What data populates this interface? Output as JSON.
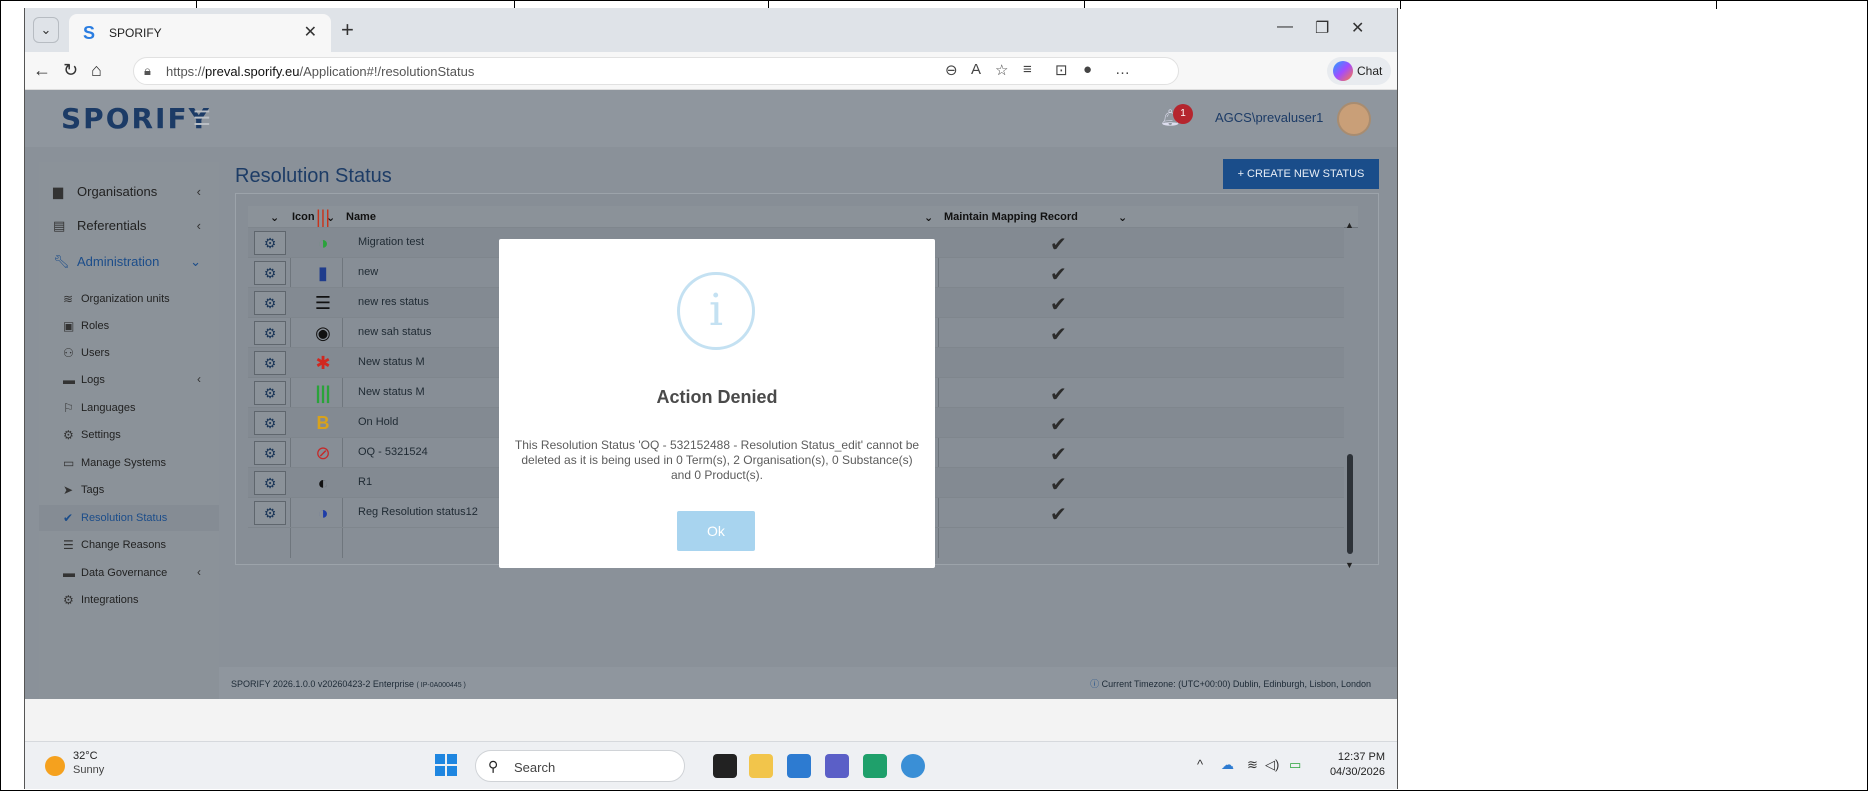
{
  "browser": {
    "tab_title": "SPORIFY",
    "tab_favicon": "S",
    "url_prefix": "https://",
    "url_domain": "preval.sporify.eu",
    "url_path": "/Application#!/resolutionStatus",
    "chat_label": "Chat"
  },
  "app": {
    "logo": "SPORIFY",
    "notification_count": "1",
    "username": "AGCS\\prevaluser1"
  },
  "sidebar": {
    "items": [
      {
        "label": "Organisations",
        "icon": "building-icon"
      },
      {
        "label": "Referentials",
        "icon": "list-icon"
      },
      {
        "label": "Administration",
        "icon": "wrench-icon"
      }
    ],
    "subitems": [
      {
        "label": "Organization units",
        "icon": "layers-icon"
      },
      {
        "label": "Roles",
        "icon": "roles-icon"
      },
      {
        "label": "Users",
        "icon": "users-icon"
      },
      {
        "label": "Logs",
        "icon": "log-icon"
      },
      {
        "label": "Languages",
        "icon": "flag-icon"
      },
      {
        "label": "Settings",
        "icon": "gear-icon"
      },
      {
        "label": "Manage Systems",
        "icon": "laptop-icon"
      },
      {
        "label": "Tags",
        "icon": "tags-icon"
      },
      {
        "label": "Resolution Status",
        "icon": "check-icon"
      },
      {
        "label": "Change Reasons",
        "icon": "menu-icon"
      },
      {
        "label": "Data Governance",
        "icon": "book-icon"
      },
      {
        "label": "Integrations",
        "icon": "cogs-icon"
      }
    ]
  },
  "page": {
    "title": "Resolution Status",
    "create_button": "+ CREATE NEW STATUS"
  },
  "table": {
    "headers": {
      "icon": "Icon",
      "name": "Name",
      "mapping": "Maintain Mapping Record"
    },
    "rows": [
      {
        "name": "Migration test",
        "icon": "half-circle-green",
        "check": true
      },
      {
        "name": "new",
        "icon": "book-blue",
        "check": true
      },
      {
        "name": "new res status",
        "icon": "align-black",
        "check": true
      },
      {
        "name": "new sah status",
        "icon": "vinyl-black",
        "check": true
      },
      {
        "name": "New status M",
        "icon": "asterisk-red",
        "check": false
      },
      {
        "name": "New status M",
        "icon": "barcode-green",
        "check": true
      },
      {
        "name": "On Hold",
        "icon": "bitcoin-yellow",
        "check": true
      },
      {
        "name": "OQ - 5321524",
        "icon": "check-circle-red",
        "check": true
      },
      {
        "name": "R1",
        "icon": "adjust-black",
        "check": true
      },
      {
        "name": "Reg Resolution status12",
        "icon": "adjust-blue",
        "check": true
      }
    ]
  },
  "footer": {
    "version": "SPORIFY 2026.1.0.0 v20260423-2 Enterprise",
    "version_code": "( IP-0A000445 )",
    "timezone": "Current Timezone: (UTC+00:00) Dublin, Edinburgh, Lisbon, London"
  },
  "modal": {
    "title": "Action Denied",
    "message": "This Resolution Status 'OQ - 532152488 - Resolution Status_edit' cannot be deleted as it is being used in 0 Term(s), 2 Organisation(s), 0 Substance(s) and 0 Product(s).",
    "ok_label": "Ok"
  },
  "taskbar": {
    "temperature": "32°C",
    "weather": "Sunny",
    "search_placeholder": "Search",
    "time": "12:37 PM",
    "date": "04/30/2026"
  }
}
